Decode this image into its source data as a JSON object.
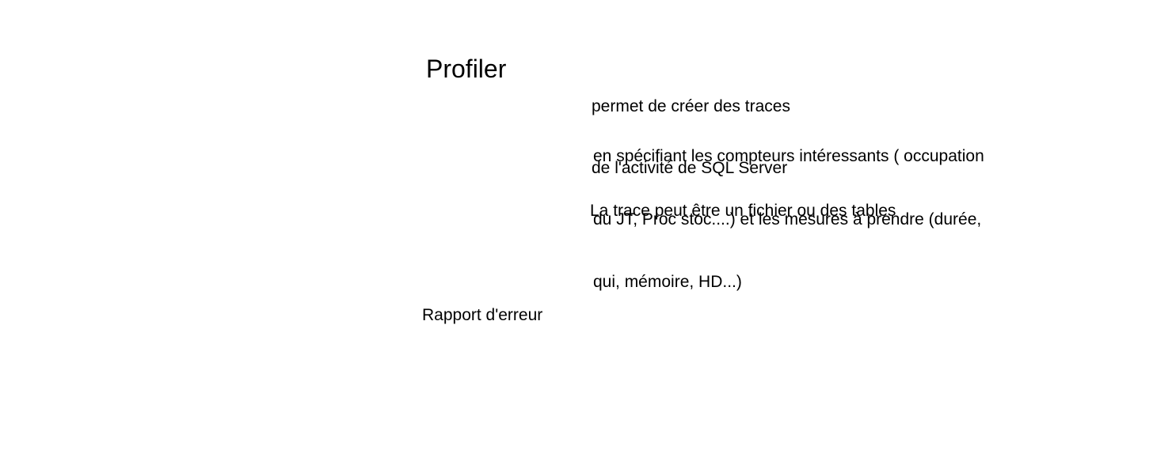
{
  "slide": {
    "heading": "Profiler",
    "description_lines": [
      "permet de créer des traces",
      "de l'activité de SQL Server"
    ],
    "detail_lines": [
      "en spécifiant les compteurs intéressants ( occupation",
      "du JT, Proc stoc....) et les mesures à prendre (durée,",
      "qui, mémoire, HD...)"
    ],
    "trace_note": "La trace peut être un fichier ou des tables",
    "report_label": "Rapport d'erreur"
  }
}
